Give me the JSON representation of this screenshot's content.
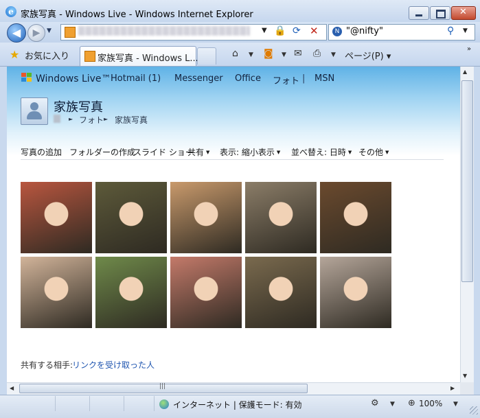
{
  "window": {
    "title": "家族写真 - Windows Live - Windows Internet Explorer"
  },
  "nav": {
    "search_provider": "\"@nifty\""
  },
  "tabbar": {
    "favorites_label": "お気に入り",
    "tab_label": "家族写真 - Windows L...",
    "page_menu": "ページ(P) ▾"
  },
  "header": {
    "brand": "Windows Live™",
    "links": [
      "Hotmail (1)",
      "Messenger",
      "Office",
      "フォト",
      "MSN"
    ],
    "page_title": "家族写真",
    "breadcrumb": [
      "フォト",
      "家族写真"
    ]
  },
  "toolbar": {
    "items": [
      {
        "label": "写真の追加",
        "dropdown": false
      },
      {
        "label": "フォルダーの作成",
        "dropdown": false
      },
      {
        "label": "スライド ショー",
        "dropdown": false
      },
      {
        "label": "共有",
        "dropdown": true
      },
      {
        "label": "表示: 縮小表示",
        "dropdown": true
      },
      {
        "label": "並べ替え: 日時",
        "dropdown": true
      },
      {
        "label": "その他",
        "dropdown": true
      }
    ]
  },
  "photos": [
    {
      "name": "photo-1",
      "bg": "#b9563f"
    },
    {
      "name": "photo-2",
      "bg": "#5d5a3a"
    },
    {
      "name": "photo-3",
      "bg": "#c99a6c"
    },
    {
      "name": "photo-4",
      "bg": "#8b7d68"
    },
    {
      "name": "photo-5",
      "bg": "#6b4a2e"
    },
    {
      "name": "photo-6",
      "bg": "#d2b49a"
    },
    {
      "name": "photo-7",
      "bg": "#6f8a4a"
    },
    {
      "name": "photo-8",
      "bg": "#c47a6a"
    },
    {
      "name": "photo-9",
      "bg": "#7a6a4e"
    },
    {
      "name": "photo-10",
      "bg": "#b5a69a"
    }
  ],
  "share": {
    "label": "共有する相手:",
    "link": "リンクを受け取った人"
  },
  "status": {
    "zone": "インターネット | 保護モード: 有効",
    "zoom": "100%"
  }
}
